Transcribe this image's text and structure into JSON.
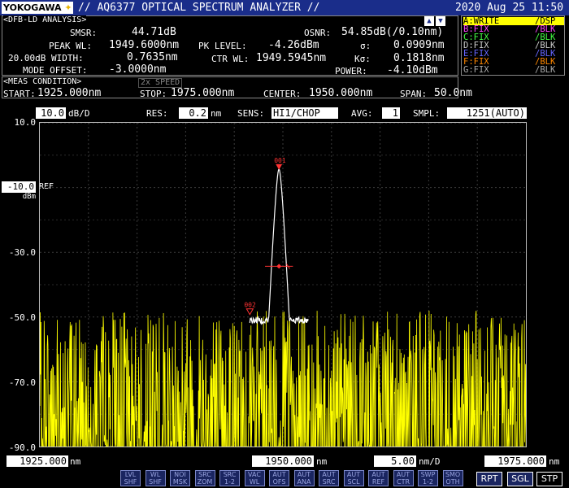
{
  "header": {
    "logo": "YOKOGAWA",
    "title": "// AQ6377 OPTICAL SPECTRUM ANALYZER //",
    "datetime": "2020 Aug 25 11:50"
  },
  "analysis": {
    "title": "<DFB-LD ANALYSIS>",
    "smsr_label": "SMSR:",
    "smsr": "44.71dB",
    "peak_wl_label": "PEAK WL:",
    "peak_wl": "1949.6000nm",
    "width_label": "20.00dB WIDTH:",
    "width": "0.7635nm",
    "mode_offset_label": "MODE OFFSET:",
    "mode_offset": "-3.0000nm",
    "pk_level_label": "PK LEVEL:",
    "pk_level": "-4.26dBm",
    "ctr_wl_label": "CTR WL:",
    "ctr_wl": "1949.5945nm",
    "osnr_label": "OSNR:",
    "osnr": "54.85dB(/0.10nm)",
    "sigma_label": "σ:",
    "sigma": "0.0909nm",
    "ksigma_label": "Kσ:",
    "ksigma": "0.1818nm",
    "power_label": "POWER:",
    "power": "-4.10dBm"
  },
  "traces": [
    {
      "name": "A:WRITE",
      "mode": "/DSP",
      "color": "#ffff00",
      "highlight": true
    },
    {
      "name": "B:FIX",
      "mode": "/BLK",
      "color": "#ff44ff"
    },
    {
      "name": "C:FIX",
      "mode": "/BLK",
      "color": "#44ff44"
    },
    {
      "name": "D:FIX",
      "mode": "/BLK",
      "color": "#cccccc"
    },
    {
      "name": "E:FIX",
      "mode": "/BLK",
      "color": "#6666ff"
    },
    {
      "name": "F:FIX",
      "mode": "/BLK",
      "color": "#ff8800"
    },
    {
      "name": "G:FIX",
      "mode": "/BLK",
      "color": "#aaaaaa"
    }
  ],
  "meas": {
    "title": "<MEAS CONDITION>",
    "speed": "2x SPEED",
    "start_label": "START:",
    "start": "1925.000nm",
    "stop_label": "STOP:",
    "stop": "1975.000nm",
    "center_label": "CENTER:",
    "center": "1950.000nm",
    "span_label": "SPAN:",
    "span": "50.0nm"
  },
  "settings": {
    "scale": "10.0",
    "scale_unit": "dB/D",
    "res_label": "RES:",
    "res": "0.2",
    "res_unit": "nm",
    "sens_label": "SENS:",
    "sens": "HI1/CHOP",
    "avg_label": "AVG:",
    "avg": "1",
    "smpl_label": "SMPL:",
    "smpl": "1251(AUTO)"
  },
  "yaxis": {
    "top": "10.0",
    "ref_value": "-10.0",
    "ref_label": "REF",
    "unit": "dBm",
    "labels": [
      "-30.0",
      "-50.0",
      "-70.0",
      "-90.0"
    ]
  },
  "xaxis": {
    "start": "1925.000",
    "start_unit": "nm",
    "center": "1950.000",
    "center_unit": "nm",
    "per_div": "5.00",
    "per_div_unit": "nm/D",
    "stop": "1975.000",
    "stop_unit": "nm"
  },
  "markers": {
    "peak": "001",
    "mode": "002"
  },
  "buttons": [
    {
      "l1": "LVL",
      "l2": "SHF"
    },
    {
      "l1": "WL",
      "l2": "SHF"
    },
    {
      "l1": "NOI",
      "l2": "MSK"
    },
    {
      "l1": "SRC",
      "l2": "ZOM"
    },
    {
      "l1": "SRC",
      "l2": "1-2"
    },
    {
      "l1": "VAC",
      "l2": "WL"
    },
    {
      "l1": "AUT",
      "l2": "OFS"
    },
    {
      "l1": "AUT",
      "l2": "ANA"
    },
    {
      "l1": "AUT",
      "l2": "SRC"
    },
    {
      "l1": "AUT",
      "l2": "SCL"
    },
    {
      "l1": "AUT",
      "l2": "REF"
    },
    {
      "l1": "AUT",
      "l2": "CTR"
    },
    {
      "l1": "SWP",
      "l2": "1-2"
    },
    {
      "l1": "SMO",
      "l2": "OTH"
    }
  ],
  "sweep_buttons": {
    "rpt": "RPT",
    "sgl": "SGL",
    "stp": "STP"
  },
  "chart_data": {
    "type": "line",
    "x_range": [
      1925.0,
      1975.0
    ],
    "y_range": [
      -90.0,
      10.0
    ],
    "ylabel": "dBm",
    "y_ticks": [
      10.0,
      -10.0,
      -30.0,
      -50.0,
      -70.0,
      -90.0
    ],
    "noise_floor_top": -50.0,
    "peak_wavelength": 1949.6,
    "peak_level": -4.26,
    "mode_marker_wavelength": 1946.6,
    "mode_marker_level": -48.97,
    "width_20db": 0.7635,
    "trace_color": "#ffff00",
    "peak_line_color": "#ffffff"
  }
}
